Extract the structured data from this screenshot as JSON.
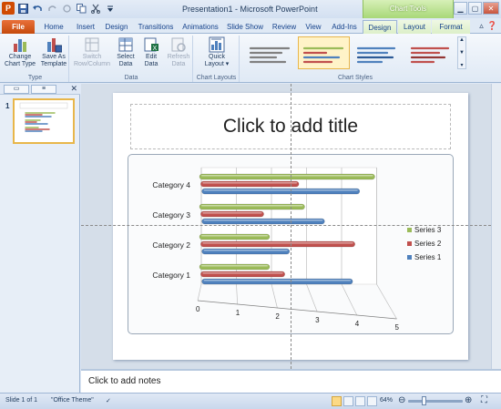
{
  "window": {
    "title": "Presentation1  -  Microsoft PowerPoint",
    "context_header": "Chart Tools"
  },
  "quick_access": {
    "icons": [
      "powerpoint-app-icon",
      "save-icon",
      "undo-icon",
      "redo-icon",
      "repeat-icon",
      "copy-icon",
      "cut-icon",
      "customize-qat-icon"
    ]
  },
  "tabs": {
    "file": "File",
    "home": "Home",
    "insert": "Insert",
    "design": "Design",
    "transitions": "Transitions",
    "animations": "Animations",
    "slideshow": "Slide Show",
    "review": "Review",
    "view": "View",
    "addins": "Add-Ins",
    "chart_design": "Design",
    "chart_layout": "Layout",
    "chart_format": "Format"
  },
  "ribbon": {
    "groups": {
      "type": "Type",
      "data": "Data",
      "chart_layouts": "Chart Layouts",
      "chart_styles": "Chart Styles"
    },
    "buttons": {
      "change_chart_type_1": "Change",
      "change_chart_type_2": "Chart Type",
      "save_as_template_1": "Save As",
      "save_as_template_2": "Template",
      "switch_row_column_1": "Switch",
      "switch_row_column_2": "Row/Column",
      "select_data_1": "Select",
      "select_data_2": "Data",
      "edit_data_1": "Edit",
      "edit_data_2": "Data",
      "refresh_data_1": "Refresh",
      "refresh_data_2": "Data",
      "quick_layout_1": "Quick",
      "quick_layout_2": "Layout ▾"
    },
    "chart_style_count_visible": 4
  },
  "slides_pane": {
    "slide_number": "1"
  },
  "slide": {
    "title_placeholder": "Click to add title"
  },
  "chart_data": {
    "type": "bar",
    "categories": [
      "Category 1",
      "Category 2",
      "Category 3",
      "Category 4"
    ],
    "series": [
      {
        "name": "Series 1",
        "values": [
          4.3,
          2.5,
          3.5,
          4.5
        ],
        "color": "#4f81bd"
      },
      {
        "name": "Series 2",
        "values": [
          2.4,
          4.4,
          1.8,
          2.8
        ],
        "color": "#c0504d"
      },
      {
        "name": "Series 3",
        "values": [
          2,
          2,
          3,
          5
        ],
        "color": "#9bbb59"
      }
    ],
    "x_ticks": [
      "0",
      "1",
      "2",
      "3",
      "4",
      "5"
    ],
    "xlim": [
      0,
      5
    ],
    "legend_position": "right",
    "grid": true,
    "three_d": true
  },
  "notes": {
    "placeholder": "Click to add notes"
  },
  "status": {
    "slide_indicator": "Slide 1 of 1",
    "theme": "\"Office Theme\"",
    "zoom": "64%"
  },
  "colors": {
    "file_tab": "#c54a0c",
    "chart_tools": "#9bd06a",
    "selection": "#e8b64a"
  }
}
